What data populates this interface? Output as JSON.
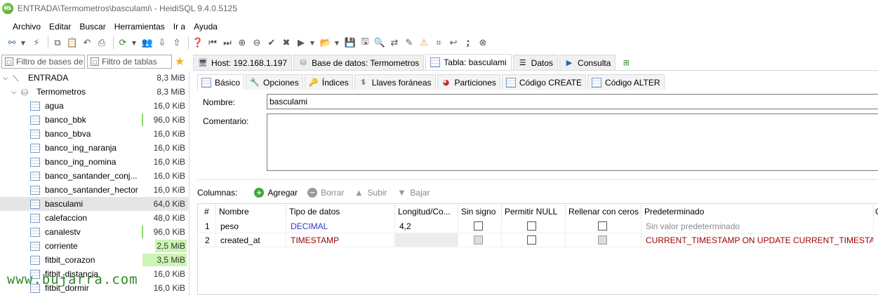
{
  "window": {
    "title": "ENTRADA\\Termometros\\basculami\\ - HeidiSQL 9.4.0.5125",
    "logo_text": "HS"
  },
  "menu": [
    "Archivo",
    "Editar",
    "Buscar",
    "Herramientas",
    "Ir a",
    "Ayuda"
  ],
  "toolbar_icons": [
    "connect-icon",
    "disconnect-icon",
    "copy-icon",
    "paste-icon",
    "undo-icon",
    "print-icon",
    "refresh-icon",
    "user-manager-icon",
    "import-icon",
    "export-icon",
    "help-icon",
    "first-icon",
    "last-icon",
    "insert-row-icon",
    "delete-row-icon",
    "post-icon",
    "cancel-icon",
    "run-icon",
    "run-dropdown-icon",
    "open-sql-icon",
    "save-sql-icon",
    "save-icon",
    "find-icon",
    "replace-icon",
    "edit-icon",
    "warning-icon",
    "format-icon",
    "wrap-icon",
    "semicolon-icon",
    "stop-icon"
  ],
  "filters": {
    "db_placeholder": "Filtro de bases de datos",
    "table_placeholder": "Filtro de tablas"
  },
  "tree": {
    "server": {
      "label": "ENTRADA",
      "size": "8,3 MiB"
    },
    "database": {
      "label": "Termometros",
      "size": "8,3 MiB"
    },
    "tables": [
      {
        "name": "agua",
        "size": "16,0 KiB",
        "bar": 0
      },
      {
        "name": "banco_bbk",
        "size": "96,0 KiB",
        "bar": 0.01
      },
      {
        "name": "banco_bbva",
        "size": "16,0 KiB",
        "bar": 0
      },
      {
        "name": "banco_ing_naranja",
        "size": "16,0 KiB",
        "bar": 0
      },
      {
        "name": "banco_ing_nomina",
        "size": "16,0 KiB",
        "bar": 0
      },
      {
        "name": "banco_santander_conj...",
        "size": "16,0 KiB",
        "bar": 0
      },
      {
        "name": "banco_santander_hector",
        "size": "16,0 KiB",
        "bar": 0
      },
      {
        "name": "basculami",
        "size": "64,0 KiB",
        "bar": 0,
        "selected": true
      },
      {
        "name": "calefaccion",
        "size": "48,0 KiB",
        "bar": 0
      },
      {
        "name": "canalestv",
        "size": "96,0 KiB",
        "bar": 0.01
      },
      {
        "name": "corriente",
        "size": "2,5 MiB",
        "bar": 0.3
      },
      {
        "name": "fitbit_corazon",
        "size": "3,5 MiB",
        "bar": 0.42
      },
      {
        "name": "fitbit_distancia",
        "size": "16,0 KiB",
        "bar": 0
      },
      {
        "name": "fitbit_dormir",
        "size": "16,0 KiB",
        "bar": 0
      }
    ]
  },
  "watermark": "www.bujarra.com",
  "main_tabs": [
    {
      "label": "Host: 192.168.1.197",
      "icon": "host-icon"
    },
    {
      "label": "Base de datos: Termometros",
      "icon": "database-icon"
    },
    {
      "label": "Tabla: basculami",
      "icon": "table-icon",
      "active": true
    },
    {
      "label": "Datos",
      "icon": "data-icon"
    },
    {
      "label": "Consulta",
      "icon": "query-icon"
    },
    {
      "label": "",
      "icon": "new-query-tab-icon"
    }
  ],
  "sub_tabs": [
    {
      "label": "Básico",
      "active": true
    },
    {
      "label": "Opciones"
    },
    {
      "label": "Índices"
    },
    {
      "label": "Llaves foráneas"
    },
    {
      "label": "Particiones"
    },
    {
      "label": "Código CREATE"
    },
    {
      "label": "Código ALTER"
    }
  ],
  "form": {
    "name_label": "Nombre:",
    "name_value": "basculami",
    "comment_label": "Comentario:",
    "comment_value": ""
  },
  "columns_bar": {
    "label": "Columnas:",
    "add": "Agregar",
    "delete": "Borrar",
    "up": "Subir",
    "down": "Bajar"
  },
  "grid": {
    "headers": [
      "#",
      "Nombre",
      "Tipo de datos",
      "Longitud/Co...",
      "Sin signo",
      "Permitir NULL",
      "Rellenar con ceros",
      "Predeterminado",
      "C"
    ],
    "rows": [
      {
        "num": "1",
        "name": "peso",
        "type": "DECIMAL",
        "length": "4,2",
        "default": "Sin valor predeterminado"
      },
      {
        "num": "2",
        "name": "created_at",
        "type": "TIMESTAMP",
        "length": "",
        "default": "CURRENT_TIMESTAMP ON UPDATE CURRENT_TIMESTAMP"
      }
    ]
  },
  "colors": {
    "decimal": "#3333cc",
    "timestamp": "#990000",
    "muted": "#8a8a8a",
    "selection": "#e5e5e5",
    "sizebar": "#cbf5b4",
    "watermark": "#2f8a2a"
  }
}
